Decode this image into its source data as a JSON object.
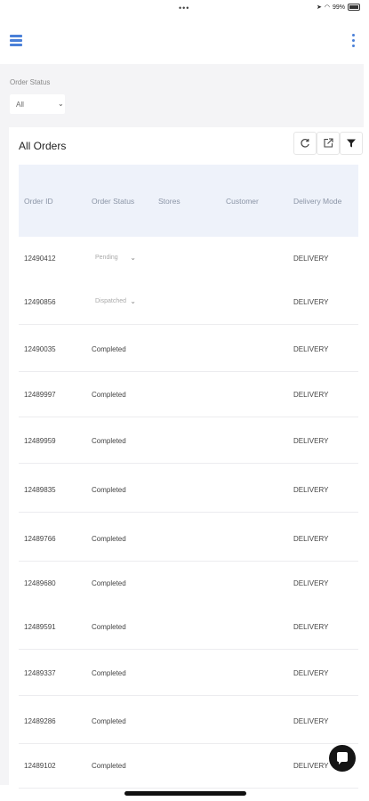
{
  "status_bar": {
    "battery": "99%"
  },
  "filter": {
    "label": "Order Status",
    "value": "All"
  },
  "card": {
    "title": "All Orders"
  },
  "table": {
    "columns": [
      "Order ID",
      "Order Status",
      "Stores",
      "Customer",
      "Delivery Mode"
    ],
    "rows": [
      {
        "id": "12490412",
        "status": "Pending",
        "dropdown": true,
        "mode": "DELIVERY"
      },
      {
        "id": "12490856",
        "status": "Dispatched",
        "dropdown": true,
        "mode": "DELIVERY"
      },
      {
        "id": "12490035",
        "status": "Completed",
        "dropdown": false,
        "mode": "DELIVERY"
      },
      {
        "id": "12489997",
        "status": "Completed",
        "dropdown": false,
        "mode": "DELIVERY"
      },
      {
        "id": "12489959",
        "status": "Completed",
        "dropdown": false,
        "mode": "DELIVERY"
      },
      {
        "id": "12489835",
        "status": "Completed",
        "dropdown": false,
        "mode": "DELIVERY"
      },
      {
        "id": "12489766",
        "status": "Completed",
        "dropdown": false,
        "mode": "DELIVERY"
      },
      {
        "id": "12489680",
        "status": "Completed",
        "dropdown": false,
        "mode": "DELIVERY"
      },
      {
        "id": "12489591",
        "status": "Completed",
        "dropdown": false,
        "mode": "DELIVERY"
      },
      {
        "id": "12489337",
        "status": "Completed",
        "dropdown": false,
        "mode": "DELIVERY"
      },
      {
        "id": "12489286",
        "status": "Completed",
        "dropdown": false,
        "mode": "DELIVERY"
      },
      {
        "id": "12489102",
        "status": "Completed",
        "dropdown": false,
        "mode": "DELIVERY"
      }
    ]
  },
  "icons": {
    "menu": "hamburger-icon",
    "more": "more-vertical-icon",
    "refresh": "refresh-icon",
    "export": "export-icon",
    "filter": "filter-icon",
    "chat": "chat-icon"
  },
  "colors": {
    "accent": "#4a80d8",
    "header_bg": "#eef2fa",
    "fab": "#151515"
  }
}
